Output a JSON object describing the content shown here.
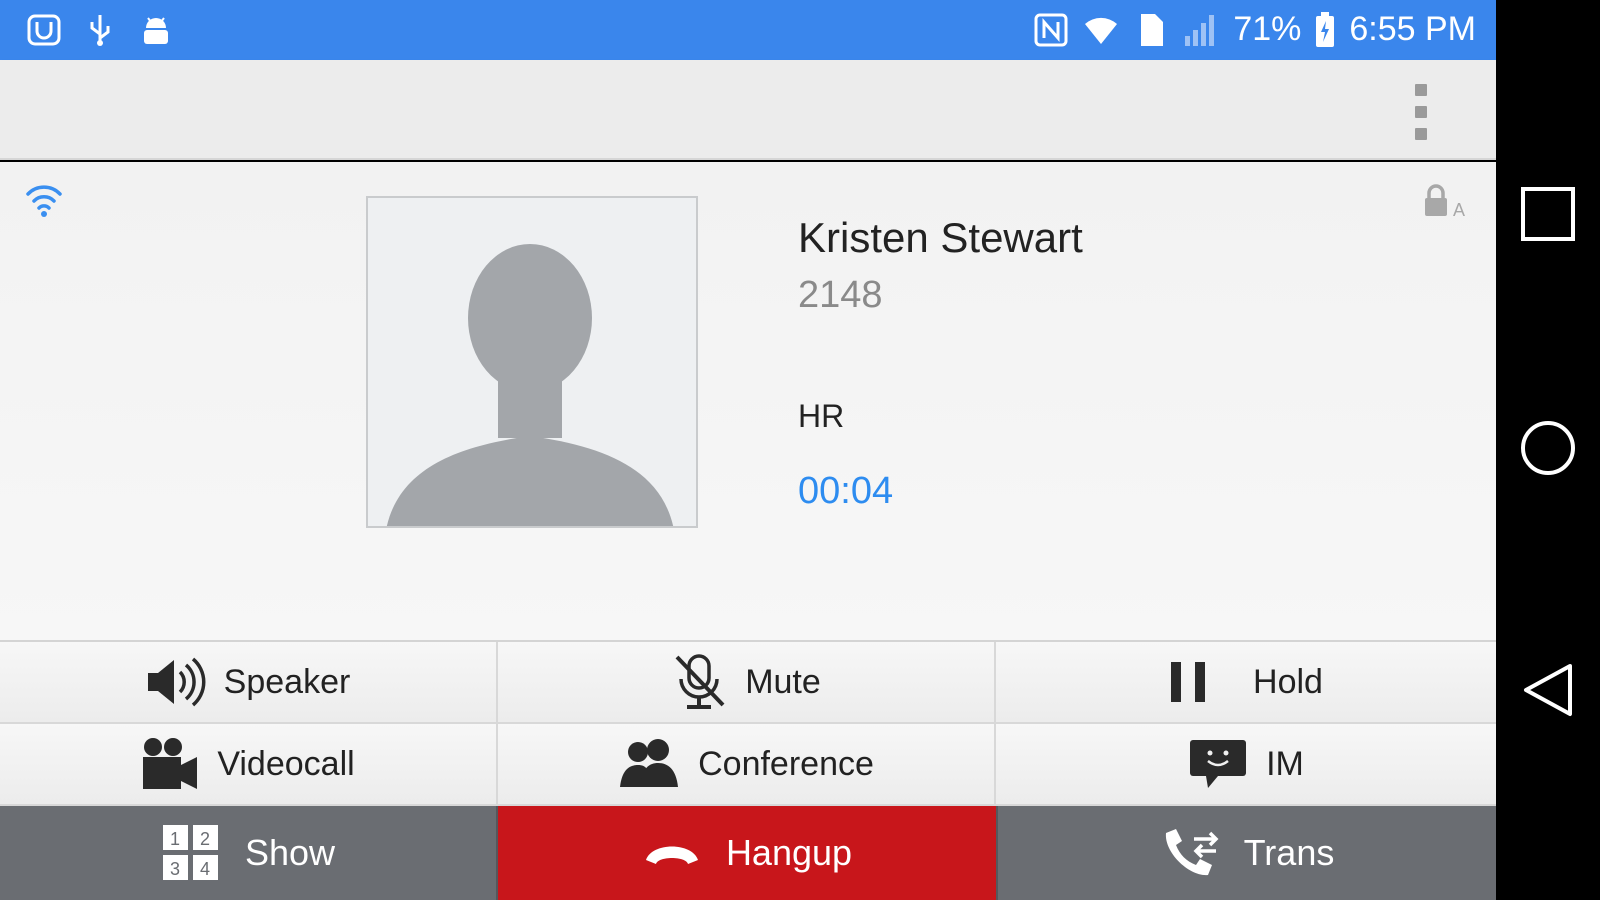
{
  "status_bar": {
    "battery_percent": "71%",
    "time": "6:55 PM",
    "left_icons": [
      "app-notification-icon",
      "usb-icon",
      "android-debug-icon"
    ],
    "right_icons": [
      "nfc-icon",
      "wifi-icon",
      "sim-icon",
      "signal-icon",
      "battery-icon"
    ]
  },
  "call": {
    "name": "Kristen Stewart",
    "number": "2148",
    "department": "HR",
    "duration": "00:04"
  },
  "controls": {
    "speaker": "Speaker",
    "mute": "Mute",
    "hold": "Hold",
    "videocall": "Videocall",
    "conference": "Conference",
    "im": "IM",
    "show": "Show",
    "hangup": "Hangup",
    "trans": "Trans"
  },
  "colors": {
    "status_bar": "#3a86ec",
    "timer": "#2d8cf0",
    "hangup": "#c8161b",
    "bottom_buttons": "#6a6d72"
  }
}
